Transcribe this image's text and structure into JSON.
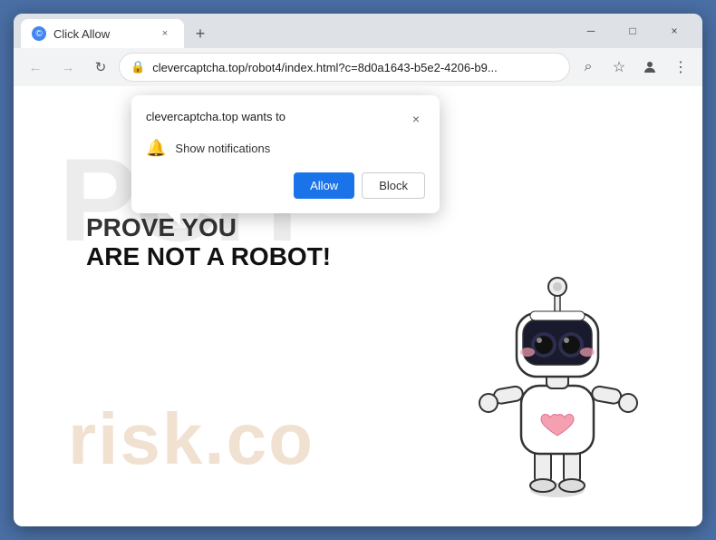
{
  "browser": {
    "tab": {
      "favicon": "©",
      "title": "Click Allow",
      "close": "×"
    },
    "new_tab_btn": "+",
    "window_controls": {
      "minimize": "─",
      "maximize": "□",
      "close": "×"
    },
    "toolbar": {
      "back": "←",
      "forward": "→",
      "reload": "↻",
      "url": "clevercaptcha.top/robot4/index.html?c=8d0a1643-b5e2-4206-b9...",
      "search_icon": "⌕",
      "bookmark_icon": "☆",
      "account_icon": "👤",
      "menu_icon": "⋮"
    }
  },
  "popup": {
    "site": "clevercaptcha.top wants to",
    "close": "×",
    "notification_label": "Show notifications",
    "allow_btn": "Allow",
    "block_btn": "Block"
  },
  "page": {
    "prove_you": "PROVE YOU",
    "are_not_robot": "ARE NOT A ROBOT!",
    "watermark_pch": "PCH",
    "watermark_risk": "risk.co"
  }
}
